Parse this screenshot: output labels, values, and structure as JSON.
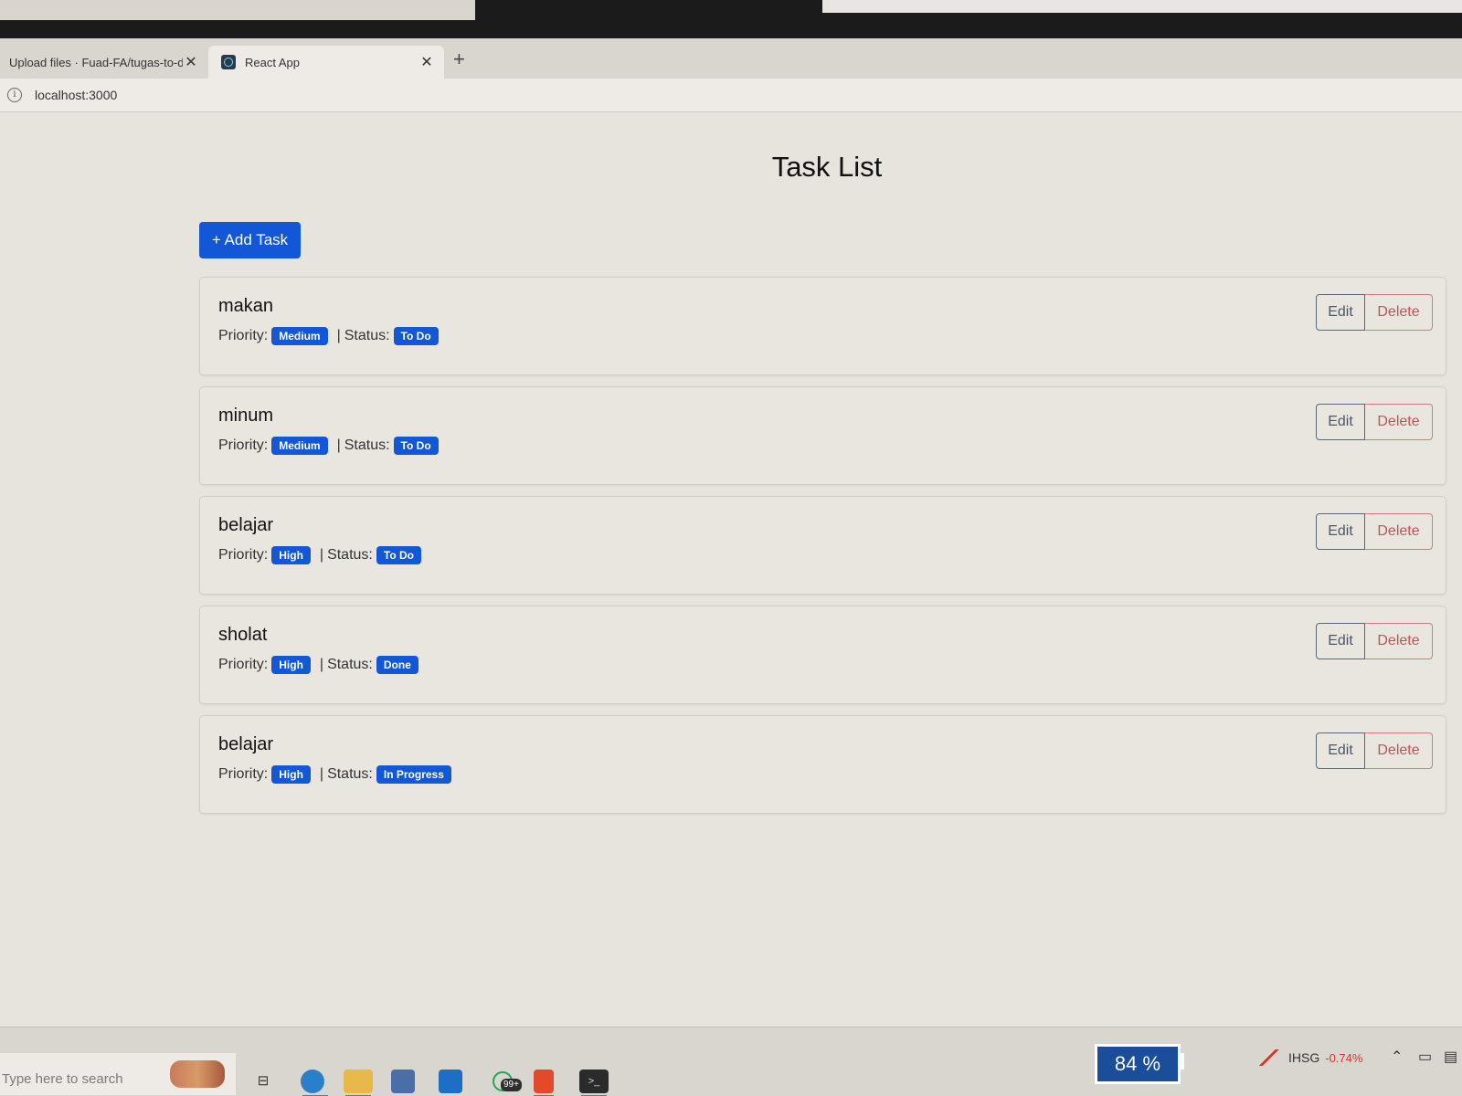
{
  "browser": {
    "tabs": [
      {
        "title": "Upload files · Fuad-FA/tugas-to-d",
        "close": "✕"
      },
      {
        "title": "React App",
        "close": "✕"
      }
    ],
    "new_tab": "+",
    "url": "localhost:3000"
  },
  "page": {
    "title": "Task List",
    "add_button": "+ Add Task",
    "priority_label": "Priority:",
    "status_label": "Status:",
    "separator": "|",
    "edit_label": "Edit",
    "delete_label": "Delete",
    "tasks": [
      {
        "title": "makan",
        "priority": "Medium",
        "status": "To Do"
      },
      {
        "title": "minum",
        "priority": "Medium",
        "status": "To Do"
      },
      {
        "title": "belajar",
        "priority": "High",
        "status": "To Do"
      },
      {
        "title": "sholat",
        "priority": "High",
        "status": "Done"
      },
      {
        "title": "belajar",
        "priority": "High",
        "status": "In Progress"
      }
    ]
  },
  "taskbar": {
    "search_placeholder": "Type here to search",
    "whatsapp_badge": "99+",
    "battery": "84 %",
    "ticker": "IHSG",
    "ticker_change": "-0.74%"
  },
  "colors": {
    "primary": "#1257d6",
    "danger": "#c9505a",
    "secondary": "#4a5566"
  }
}
